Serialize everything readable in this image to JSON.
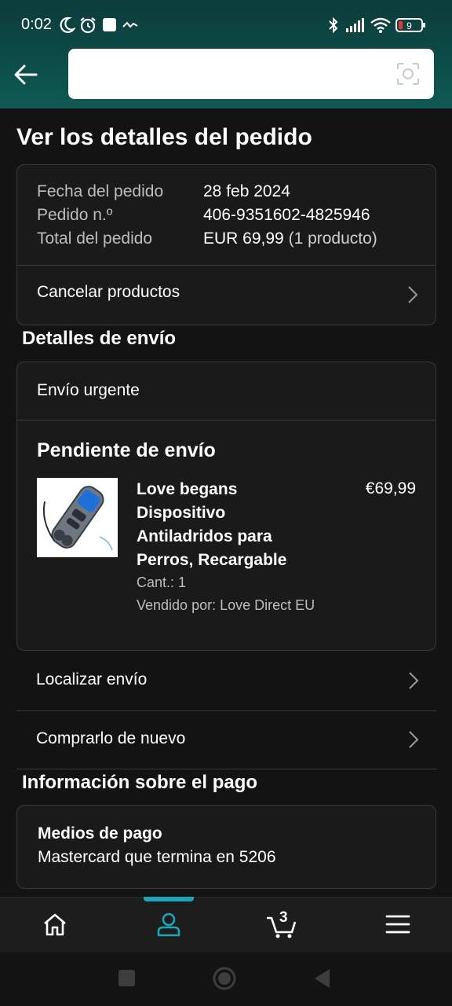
{
  "status_bar": {
    "time": "0:02",
    "icons": [
      "moon-icon",
      "alarm-icon",
      "square-icon",
      "activity-icon",
      "bluetooth-icon",
      "signal-icon",
      "wifi-icon",
      "battery-icon"
    ],
    "battery": "9"
  },
  "header": {
    "back_icon": "arrow-left-icon",
    "search_value": "",
    "camera_icon": "camera-scan-icon"
  },
  "page": {
    "title": "Ver los detalles del pedido"
  },
  "order_summary": {
    "date_label": "Fecha del pedido",
    "date_value": "28 feb 2024",
    "number_label": "Pedido n.º",
    "number_value": "406-9351602-4825946",
    "total_label": "Total del pedido",
    "total_value": "EUR 69,99",
    "total_qty": "(1 producto)",
    "cancel_label": "Cancelar productos"
  },
  "shipping": {
    "section_title": "Detalles de envío",
    "method": "Envío urgente",
    "status": "Pendiente de envío",
    "product": {
      "name": "Love begans Dispositivo Antiladridos para Perros, Recargable",
      "price": "€69,99",
      "qty": "Cant.: 1",
      "seller": "Vendido por: Love Direct EU"
    },
    "track_label": "Localizar envío",
    "buy_again_label": "Comprarlo de nuevo"
  },
  "payment": {
    "section_title": "Información sobre el pago",
    "methods_label": "Medios de pago",
    "card_text": "Mastercard  que termina en 5206"
  },
  "bottom_nav": {
    "items": [
      "home-icon",
      "account-icon",
      "cart-icon",
      "menu-icon"
    ],
    "cart_count": "3",
    "active": "account-icon",
    "accent_color": "#1ba5b8"
  },
  "system_nav": [
    "recents-button",
    "home-button",
    "back-button"
  ]
}
